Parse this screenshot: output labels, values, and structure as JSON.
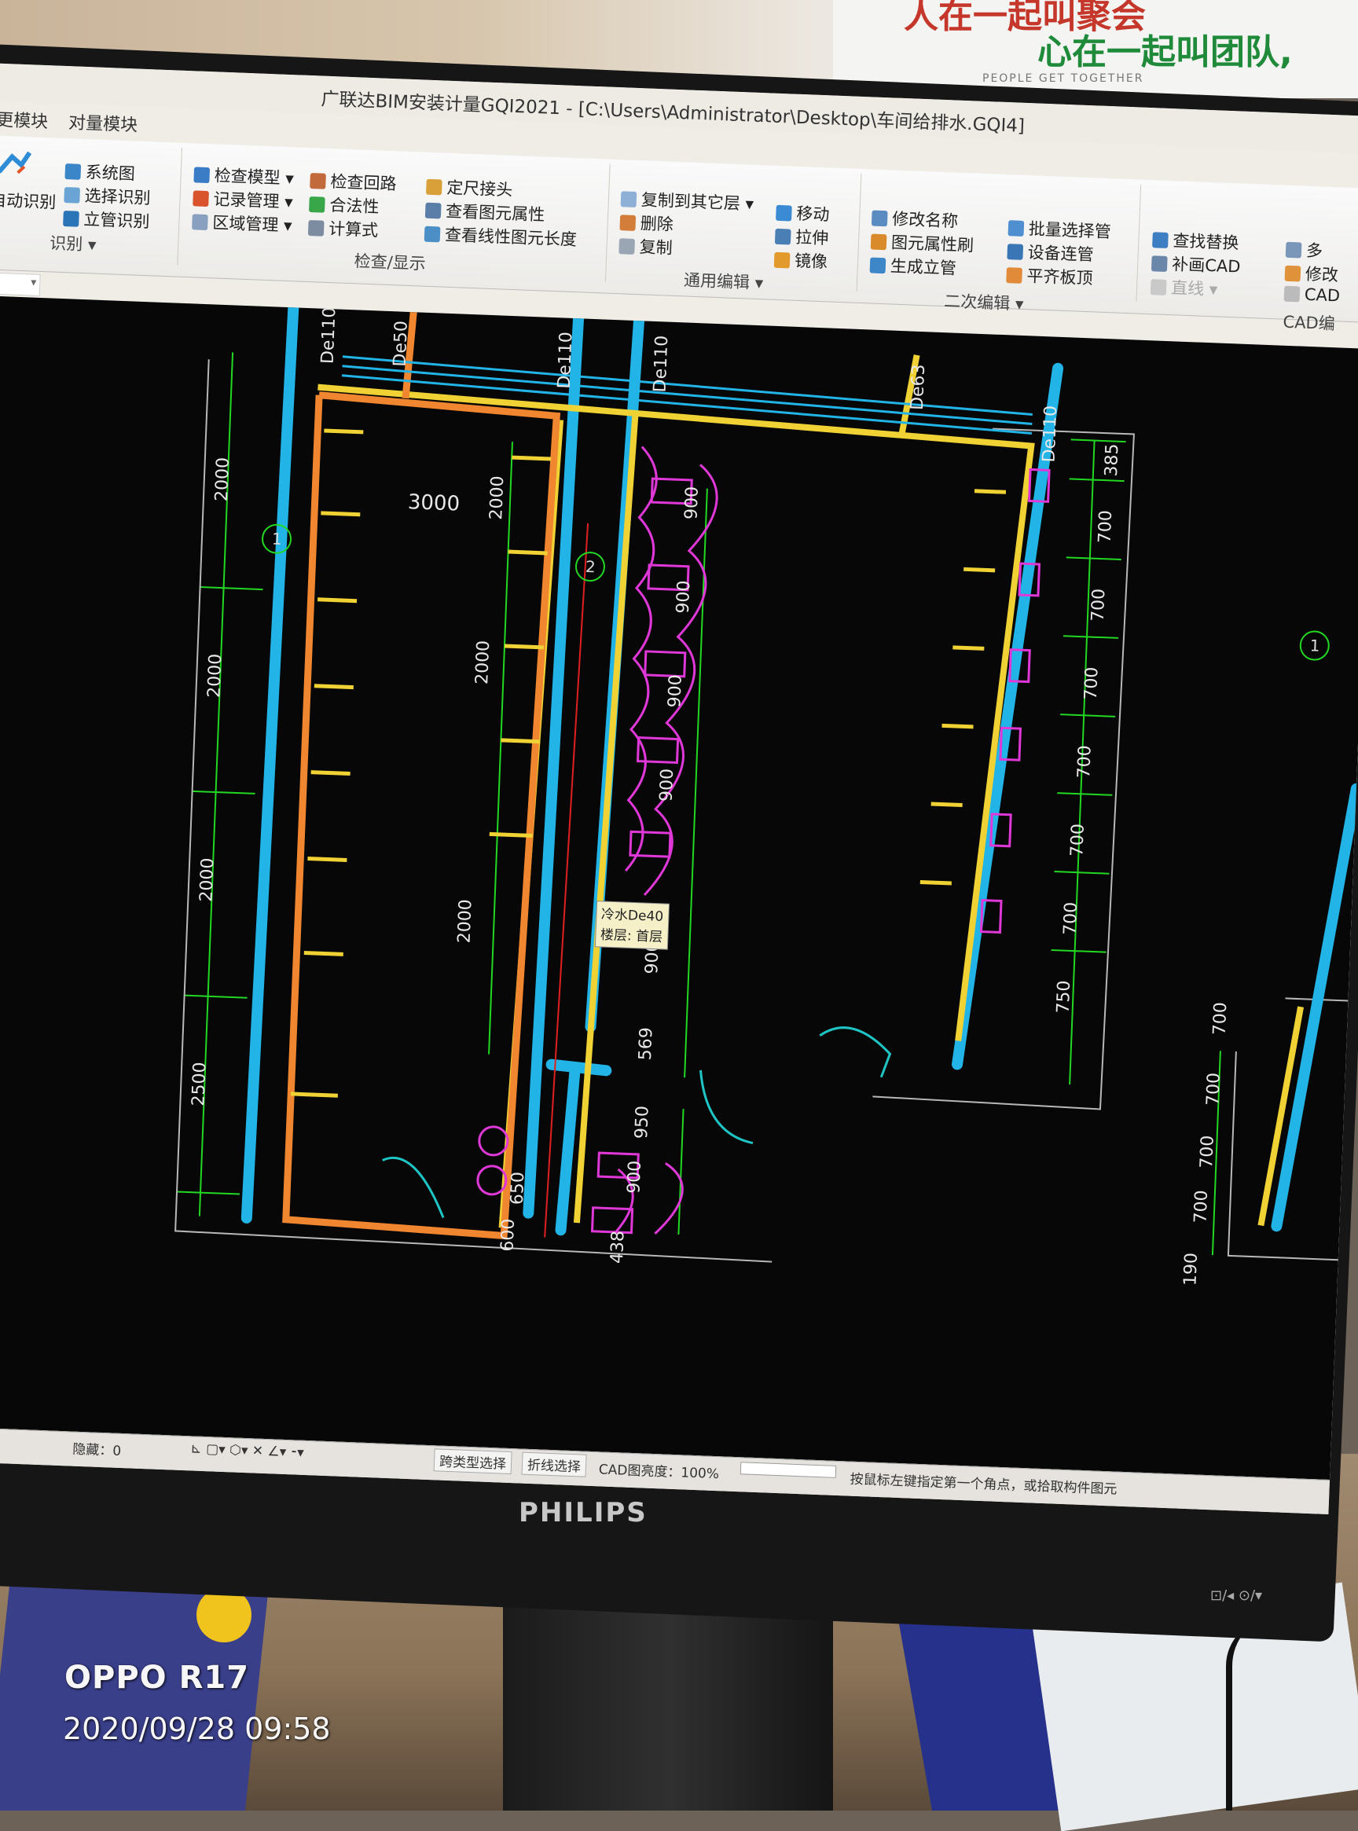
{
  "scene": {
    "poster_line1": "人在一起叫聚会",
    "poster_line2": "心在一起叫团队,",
    "poster_small": "PEOPLE GET TOGETHER",
    "monitor_brand": "PHILIPS",
    "bezel_buttons": "⊡/◂   ⊙/▾",
    "watermark_model": "OPPO R17",
    "watermark_datetime": "2020/09/28 09:58"
  },
  "app": {
    "title": "广联达BIM安装计量GQI2021 - [C:\\Users\\Administrator\\Desktop\\车间给排水.GQI4]",
    "tabs": [
      "更模块",
      "对量模块"
    ]
  },
  "ribbon": {
    "identify": {
      "auto": "自动识别",
      "system": "系统图",
      "select": "选择识别",
      "riser": "立管识别",
      "group": "识别 ▾"
    },
    "check": {
      "model": "检查模型 ▾",
      "records": "记录管理 ▾",
      "area": "区域管理 ▾",
      "loop": "检查回路",
      "legality": "合法性",
      "formula": "计算式",
      "fixed_joint": "定尺接头",
      "view_attr": "查看图元属性",
      "view_length": "查看线性图元长度",
      "group": "检查/显示"
    },
    "edit": {
      "copy_layer": "复制到其它层 ▾",
      "delete": "删除",
      "copy": "复制",
      "move": "移动",
      "stretch": "拉伸",
      "mirror": "镜像",
      "group": "通用编辑 ▾"
    },
    "edit2": {
      "rename": "修改名称",
      "attr_brush": "图元属性刷",
      "gen_riser": "生成立管",
      "batch_pipe": "批量选择管",
      "equip_pipe": "设备连管",
      "flush_top": "平齐板顶",
      "group": "二次编辑 ▾"
    },
    "cad": {
      "find_replace": "查找替换",
      "add_cad": "补画CAD",
      "line": "直线 ▾",
      "more1": "多",
      "more2": "修改",
      "more3": "CAD",
      "group": "CAD编"
    }
  },
  "drawing": {
    "pipe_labels": [
      "De110",
      "De50",
      "De110",
      "De110",
      "De63",
      "De110"
    ],
    "room_dim": "3000",
    "left_dims": [
      "2000",
      "2000",
      "2000",
      "2500"
    ],
    "inner_dims": [
      "2000",
      "2000",
      "2000"
    ],
    "stall_dims": [
      "900",
      "900",
      "900",
      "900",
      "900",
      "569"
    ],
    "right_dims": [
      "385",
      "700",
      "700",
      "700",
      "700",
      "700",
      "700",
      "750"
    ],
    "lower_dims": [
      "950",
      "900",
      "650",
      "600",
      "438"
    ],
    "far_right_dims": [
      "700",
      "700",
      "700",
      "700",
      "190"
    ],
    "axis_markers": [
      "1",
      "2",
      "1"
    ],
    "tooltip_line1": "冷水De40",
    "tooltip_line2": "楼层: 首层"
  },
  "status": {
    "coord": "0",
    "hidden": "隐藏：0",
    "cross_select": "跨类型选择",
    "polyline_select": "折线选择",
    "cad_brightness": "CAD图亮度：100%",
    "prompt": "按鼠标左键指定第一个角点，或拾取构件图元"
  },
  "colors": {
    "cad_background": "#070707",
    "cold_water": "#22b4e6",
    "drain": "#f0d235",
    "waste": "#f0862f",
    "fixture": "#e038d8",
    "dimension": "#22d822"
  }
}
